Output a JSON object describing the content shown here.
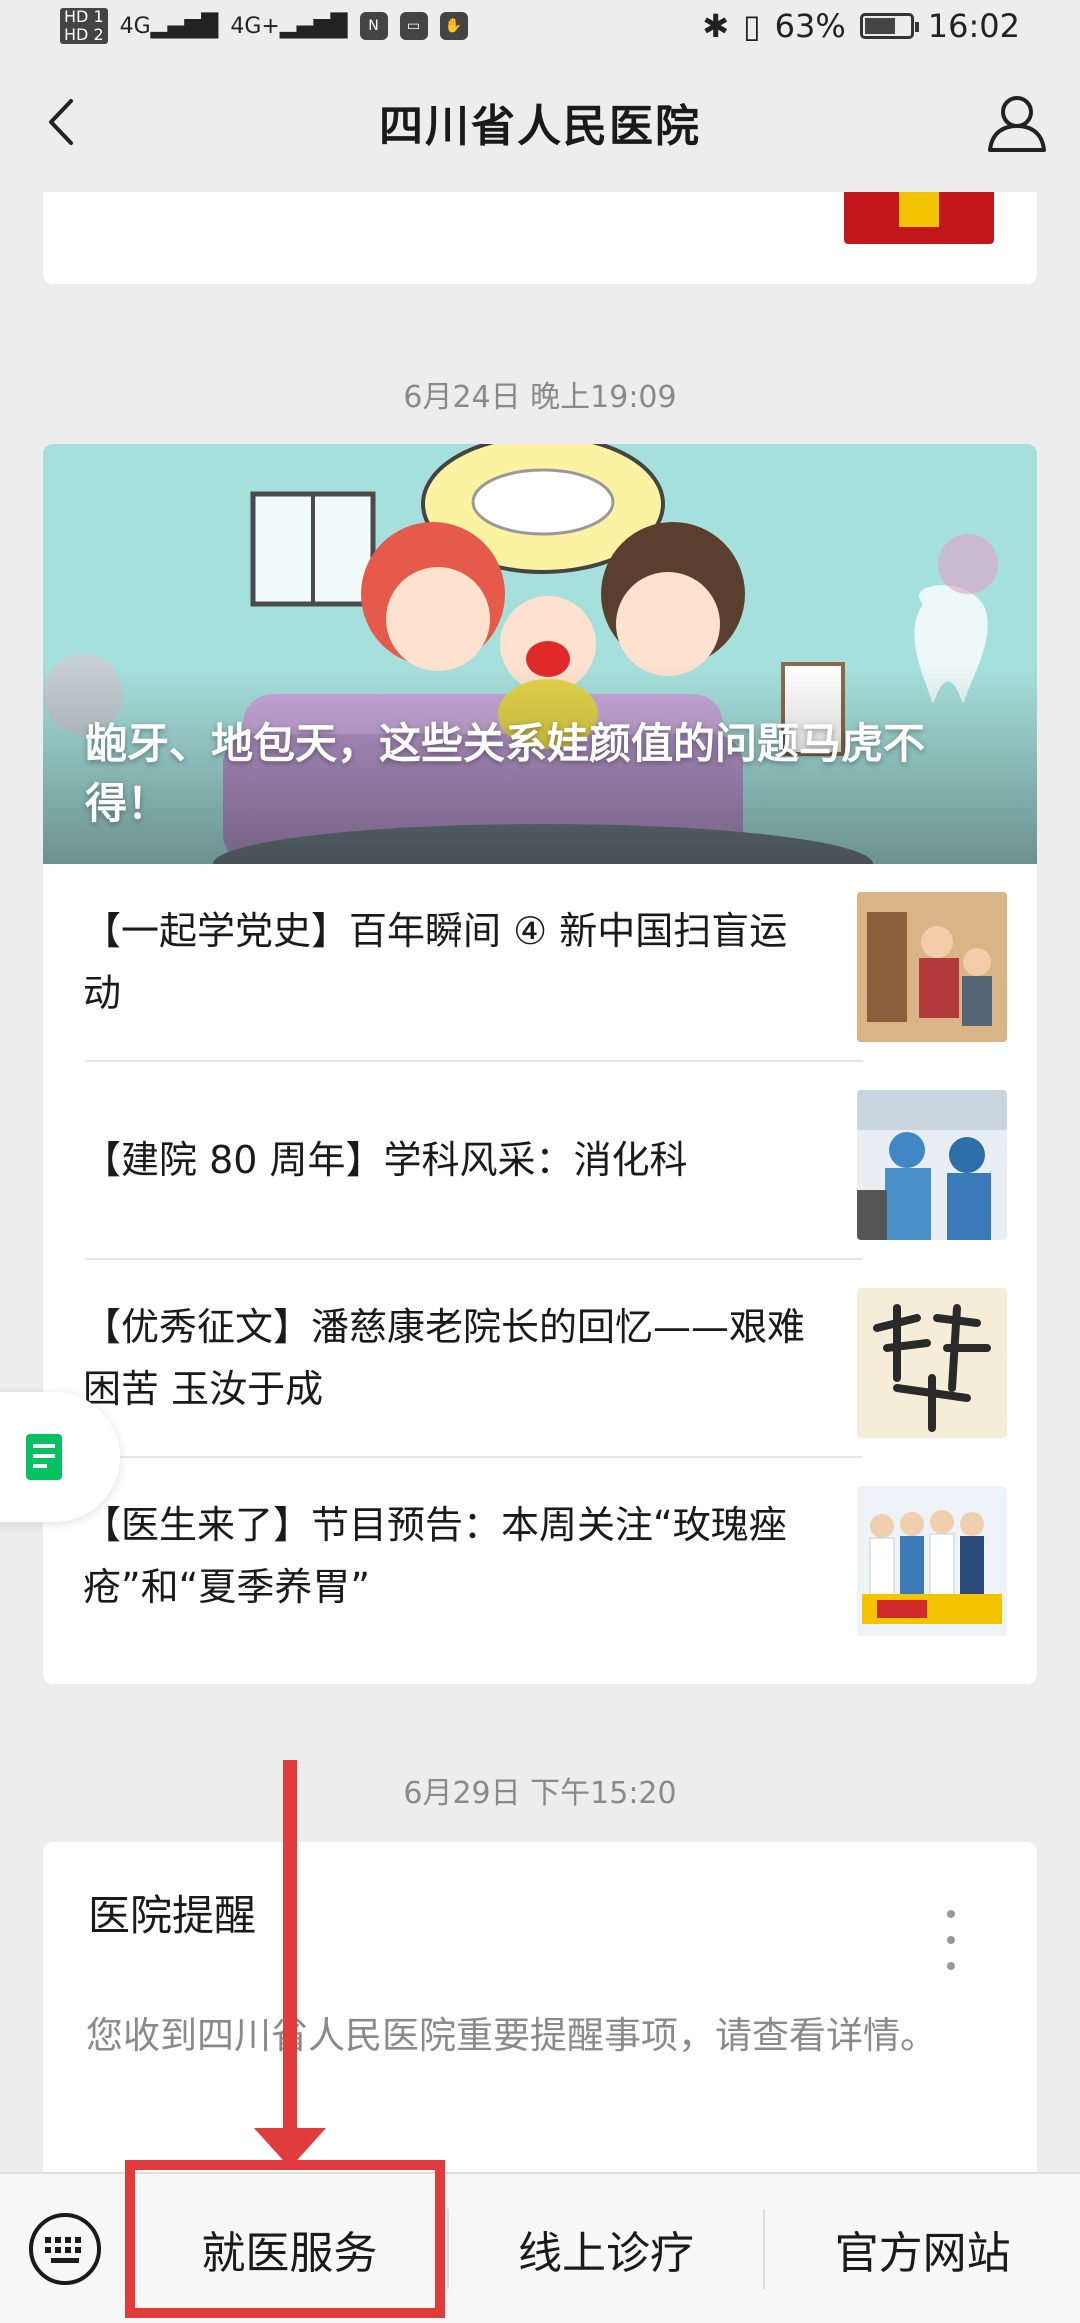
{
  "status_bar": {
    "hd1": "HD 1",
    "hd2": "HD 2",
    "net1": "4G",
    "net2": "4G+",
    "battery_text": "63%",
    "battery_level": 0.63,
    "time": "16:02"
  },
  "nav": {
    "title": "四川省人民医院"
  },
  "feed": {
    "timestamp1": "6月24日 晚上19:09",
    "hero_caption": "龅牙、地包天，这些关系娃颜值的问题马虎不得！",
    "articles": [
      {
        "title": "【一起学党史】百年瞬间 ④ 新中国扫盲运动"
      },
      {
        "title": "【建院 80 周年】学科风采：消化科"
      },
      {
        "title": "【优秀征文】潘慈康老院长的回忆——艰难困苦 玉汝于成"
      },
      {
        "title": "【医生来了】节目预告：本周关注“玫瑰痤疮”和“夏季养胃”"
      }
    ],
    "timestamp2": "6月29日 下午15:20",
    "reminder": {
      "title": "医院提醒",
      "body": "您收到四川省人民医院重要提醒事项，请查看详情。"
    }
  },
  "bottom_menu": {
    "items": [
      "就医服务",
      "线上诊疗",
      "官方网站"
    ]
  },
  "colors": {
    "accent_red": "#e23b3b",
    "wechat_green": "#07c160",
    "background": "#ededed"
  }
}
